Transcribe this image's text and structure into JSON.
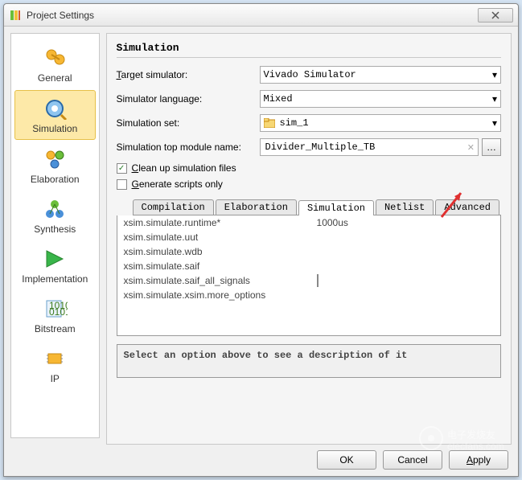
{
  "window": {
    "title": "Project Settings"
  },
  "sidebar": {
    "items": [
      {
        "label": "General"
      },
      {
        "label": "Simulation"
      },
      {
        "label": "Elaboration"
      },
      {
        "label": "Synthesis"
      },
      {
        "label": "Implementation"
      },
      {
        "label": "Bitstream"
      },
      {
        "label": "IP"
      }
    ]
  },
  "panel": {
    "title": "Simulation",
    "labels": {
      "target_simulator": "Target simulator:",
      "simulator_language": "Simulator language:",
      "simulation_set": "Simulation set:",
      "top_module": "Simulation top module name:",
      "cleanup": "Clean up simulation files",
      "genscript": "Generate scripts only"
    },
    "values": {
      "target_simulator": "Vivado Simulator",
      "simulator_language": "Mixed",
      "simulation_set": "sim_1",
      "top_module": "Divider_Multiple_TB"
    },
    "cleanup_checked": true,
    "genscript_checked": false
  },
  "tabs": {
    "items": [
      {
        "label": "Compilation"
      },
      {
        "label": "Elaboration"
      },
      {
        "label": "Simulation"
      },
      {
        "label": "Netlist"
      },
      {
        "label": "Advanced"
      }
    ],
    "active_index": 2,
    "properties": [
      {
        "name": "xsim.simulate.runtime*",
        "value": "1000us",
        "type": "text"
      },
      {
        "name": "xsim.simulate.uut",
        "value": "",
        "type": "text"
      },
      {
        "name": "xsim.simulate.wdb",
        "value": "",
        "type": "text"
      },
      {
        "name": "xsim.simulate.saif",
        "value": "",
        "type": "text"
      },
      {
        "name": "xsim.simulate.saif_all_signals",
        "value": "",
        "type": "check",
        "checked": false
      },
      {
        "name": "xsim.simulate.xsim.more_options",
        "value": "",
        "type": "text"
      }
    ]
  },
  "description": "Select an option above to see a description of it",
  "buttons": {
    "ok": "OK",
    "cancel": "Cancel",
    "apply": "Apply"
  },
  "watermark_text": "电子发烧友"
}
